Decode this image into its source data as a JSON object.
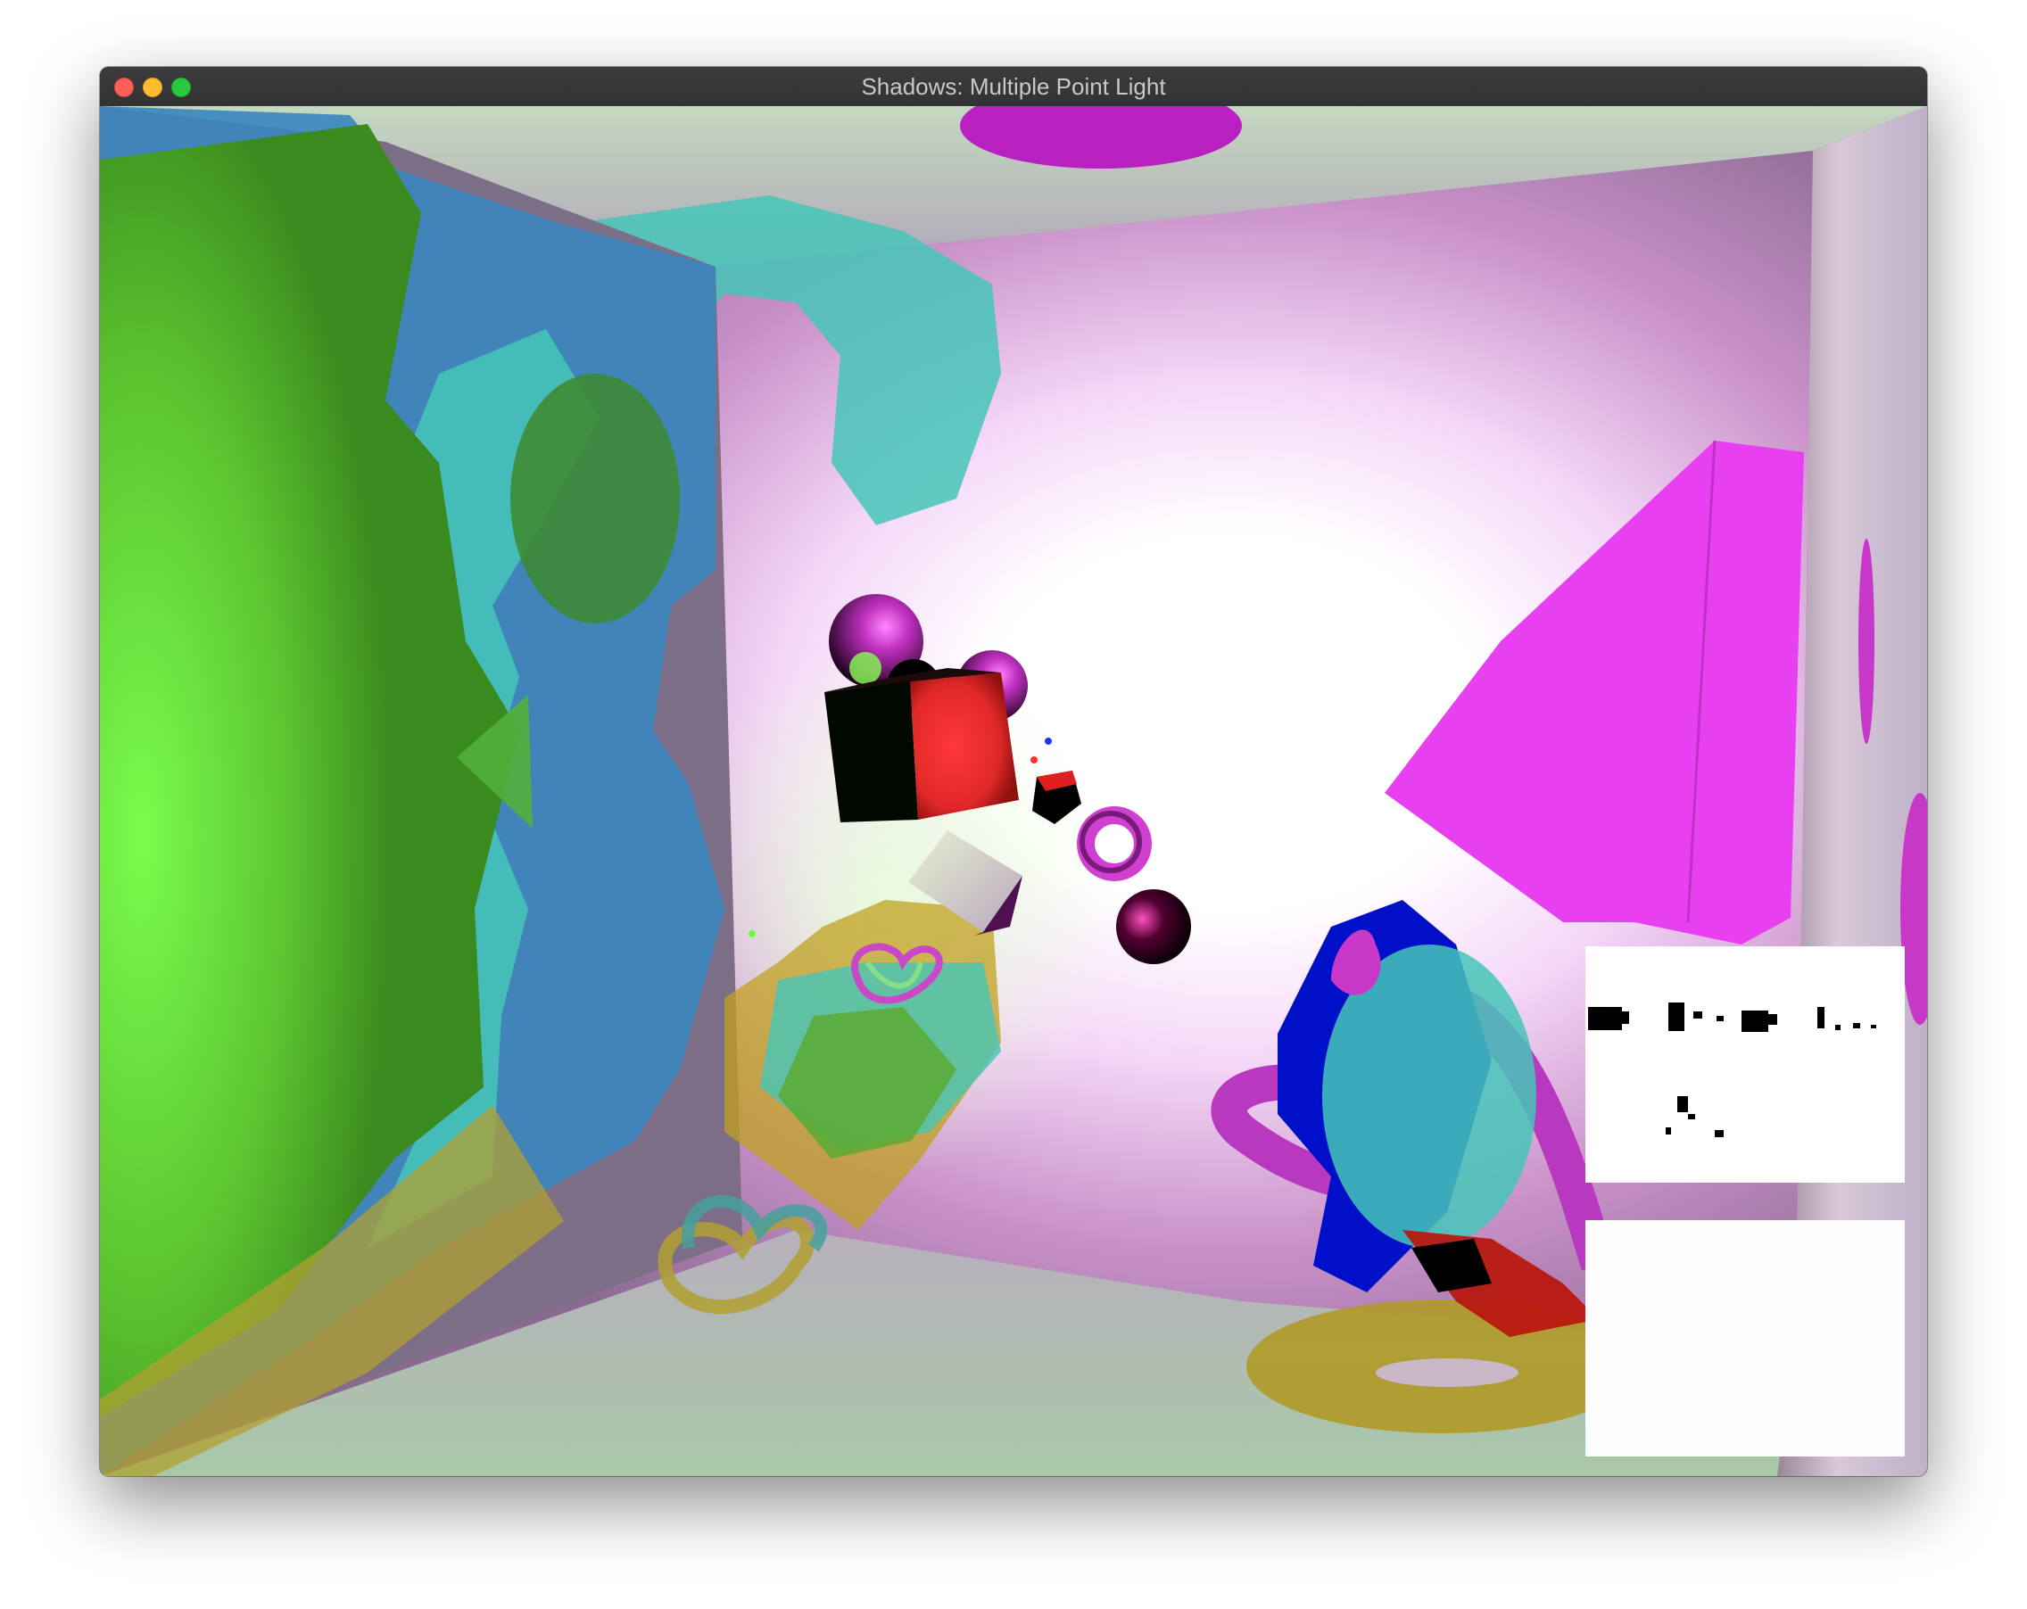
{
  "window": {
    "title": "Shadows: Multiple Point Light"
  },
  "icons": {
    "close": "close-icon",
    "minimize": "minimize-icon",
    "zoom": "zoom-icon"
  },
  "colors": {
    "titlebar": "#37373a",
    "light_red": "#ff3030",
    "light_green": "#66ff44",
    "light_blue": "#2233ff",
    "wall_magenta": "#e840f0",
    "shadow_cyan": "#45c6b8",
    "shadow_blue": "#3a86c0",
    "shadow_yellow": "#b0a030",
    "floor_green": "#6ad840"
  },
  "panels": {
    "shadow_map_1": "shadow-map-preview",
    "shadow_map_2": "shadow-map-preview-blank"
  }
}
